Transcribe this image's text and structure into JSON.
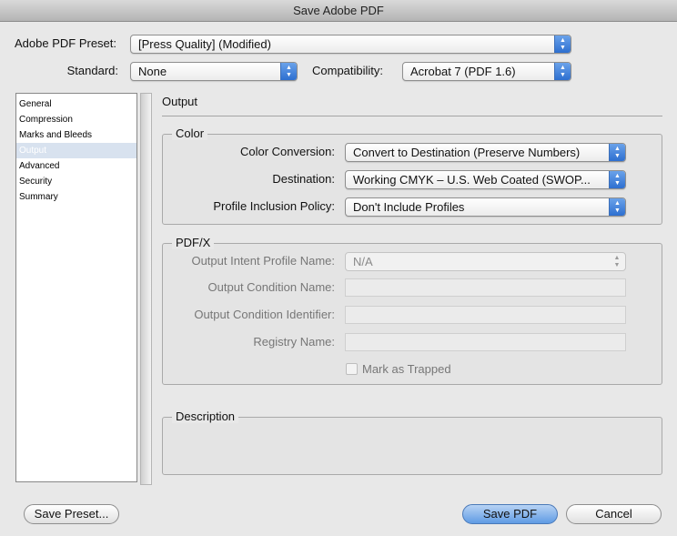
{
  "window": {
    "title": "Save Adobe PDF"
  },
  "top": {
    "preset_label": "Adobe PDF Preset:",
    "preset_value": "[Press Quality] (Modified)",
    "standard_label": "Standard:",
    "standard_value": "None",
    "compat_label": "Compatibility:",
    "compat_value": "Acrobat 7 (PDF 1.6)"
  },
  "sidebar": {
    "items": [
      {
        "label": "General"
      },
      {
        "label": "Compression"
      },
      {
        "label": "Marks and Bleeds"
      },
      {
        "label": "Output"
      },
      {
        "label": "Advanced"
      },
      {
        "label": "Security"
      },
      {
        "label": "Summary"
      }
    ],
    "selected": "Output"
  },
  "panel": {
    "title": "Output",
    "color": {
      "legend": "Color",
      "conversion_label": "Color Conversion:",
      "conversion_value": "Convert to Destination (Preserve Numbers)",
      "destination_label": "Destination:",
      "destination_value": "Working CMYK – U.S. Web Coated (SWOP...",
      "profile_label": "Profile Inclusion Policy:",
      "profile_value": "Don't Include Profiles"
    },
    "pdfx": {
      "legend": "PDF/X",
      "intent_label": "Output Intent Profile Name:",
      "intent_value": "N/A",
      "condition_name_label": "Output Condition Name:",
      "condition_id_label": "Output Condition Identifier:",
      "registry_label": "Registry Name:",
      "trapped_label": "Mark as Trapped"
    },
    "description": {
      "legend": "Description"
    }
  },
  "buttons": {
    "save_preset": "Save Preset...",
    "save_pdf": "Save PDF",
    "cancel": "Cancel"
  },
  "colors": {
    "accent": "#2d6fd0",
    "selection": "#d8e2ef"
  },
  "icons": {
    "popup": "up-down-arrows-icon",
    "checkbox": "checkbox-icon"
  }
}
